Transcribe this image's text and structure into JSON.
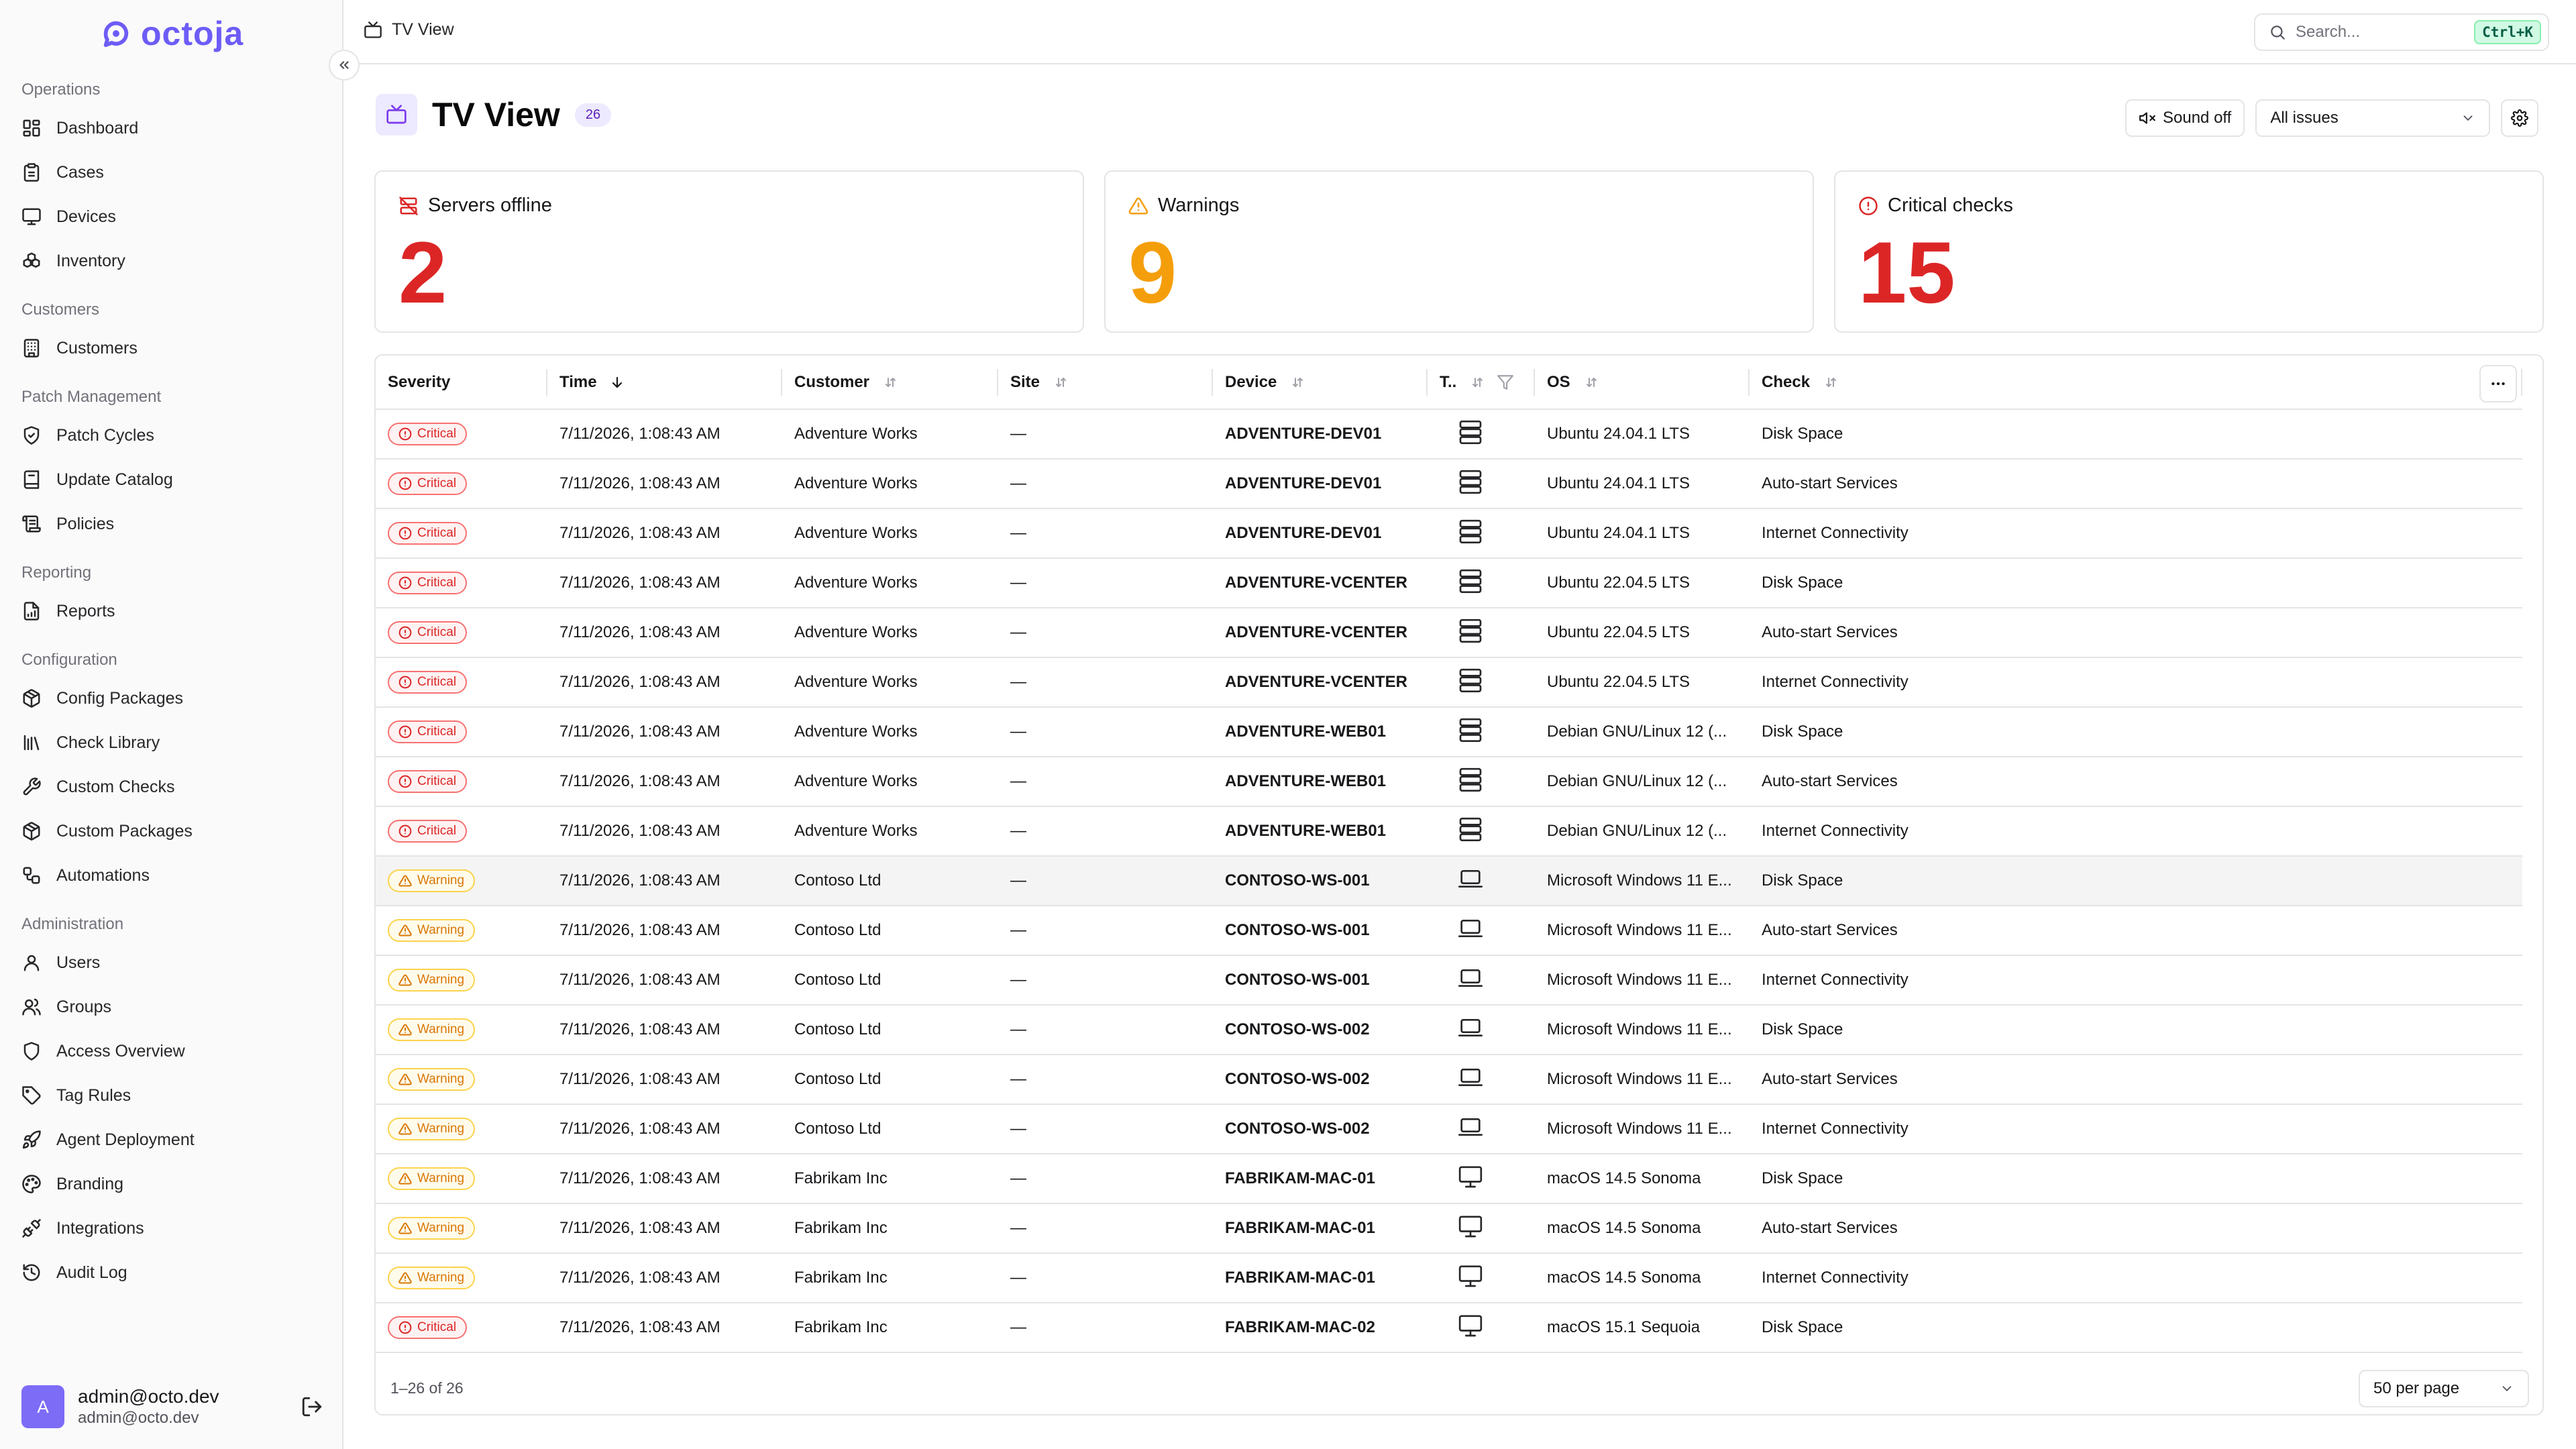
{
  "brand": {
    "name": "octoja",
    "color": "#6d5cf6"
  },
  "sidebar": {
    "sections": [
      {
        "title": "Operations",
        "items": [
          {
            "label": "Dashboard",
            "icon": "dashboard-icon"
          },
          {
            "label": "Cases",
            "icon": "clipboard-icon"
          },
          {
            "label": "Devices",
            "icon": "monitor-icon"
          },
          {
            "label": "Inventory",
            "icon": "boxes-icon"
          }
        ]
      },
      {
        "title": "Customers",
        "items": [
          {
            "label": "Customers",
            "icon": "building-icon"
          }
        ]
      },
      {
        "title": "Patch Management",
        "items": [
          {
            "label": "Patch Cycles",
            "icon": "shield-check-icon"
          },
          {
            "label": "Update Catalog",
            "icon": "book-icon"
          },
          {
            "label": "Policies",
            "icon": "scroll-icon"
          }
        ]
      },
      {
        "title": "Reporting",
        "items": [
          {
            "label": "Reports",
            "icon": "file-chart-icon"
          }
        ]
      },
      {
        "title": "Configuration",
        "items": [
          {
            "label": "Config Packages",
            "icon": "package-icon"
          },
          {
            "label": "Check Library",
            "icon": "library-icon"
          },
          {
            "label": "Custom Checks",
            "icon": "wrench-icon"
          },
          {
            "label": "Custom Packages",
            "icon": "package-icon"
          },
          {
            "label": "Automations",
            "icon": "workflow-icon"
          }
        ]
      },
      {
        "title": "Administration",
        "items": [
          {
            "label": "Users",
            "icon": "user-icon"
          },
          {
            "label": "Groups",
            "icon": "users-icon"
          },
          {
            "label": "Access Overview",
            "icon": "shield-icon"
          },
          {
            "label": "Tag Rules",
            "icon": "tag-icon"
          },
          {
            "label": "Agent Deployment",
            "icon": "rocket-icon"
          },
          {
            "label": "Branding",
            "icon": "palette-icon"
          },
          {
            "label": "Integrations",
            "icon": "plug-icon"
          },
          {
            "label": "Audit Log",
            "icon": "history-icon"
          }
        ]
      }
    ]
  },
  "user": {
    "initial": "A",
    "name": "admin@octo.dev",
    "email": "admin@octo.dev"
  },
  "topbar": {
    "breadcrumb": "TV View",
    "search_placeholder": "Search...",
    "shortcut": "Ctrl+K"
  },
  "page": {
    "title": "TV View",
    "count": "26",
    "sound_label": "Sound off",
    "filter_value": "All issues"
  },
  "stats": [
    {
      "label": "Servers offline",
      "value": "2",
      "color": "#dc2626",
      "icon": "server-off-icon"
    },
    {
      "label": "Warnings",
      "value": "9",
      "color": "#f59e0b",
      "icon": "warning-triangle-icon"
    },
    {
      "label": "Critical checks",
      "value": "15",
      "color": "#dc2626",
      "icon": "alert-circle-icon"
    }
  ],
  "table": {
    "columns": [
      "Severity",
      "Time",
      "Customer",
      "Site",
      "Device",
      "T..",
      "OS",
      "Check"
    ],
    "rows": [
      {
        "severity": "Critical",
        "time": "7/11/2026, 1:08:43 AM",
        "customer": "Adventure Works",
        "site": "—",
        "device": "ADVENTURE-DEV01",
        "type": "server",
        "os": "Ubuntu 24.04.1 LTS",
        "check": "Disk Space"
      },
      {
        "severity": "Critical",
        "time": "7/11/2026, 1:08:43 AM",
        "customer": "Adventure Works",
        "site": "—",
        "device": "ADVENTURE-DEV01",
        "type": "server",
        "os": "Ubuntu 24.04.1 LTS",
        "check": "Auto-start Services"
      },
      {
        "severity": "Critical",
        "time": "7/11/2026, 1:08:43 AM",
        "customer": "Adventure Works",
        "site": "—",
        "device": "ADVENTURE-DEV01",
        "type": "server",
        "os": "Ubuntu 24.04.1 LTS",
        "check": "Internet Connectivity"
      },
      {
        "severity": "Critical",
        "time": "7/11/2026, 1:08:43 AM",
        "customer": "Adventure Works",
        "site": "—",
        "device": "ADVENTURE-VCENTER",
        "type": "server",
        "os": "Ubuntu 22.04.5 LTS",
        "check": "Disk Space"
      },
      {
        "severity": "Critical",
        "time": "7/11/2026, 1:08:43 AM",
        "customer": "Adventure Works",
        "site": "—",
        "device": "ADVENTURE-VCENTER",
        "type": "server",
        "os": "Ubuntu 22.04.5 LTS",
        "check": "Auto-start Services"
      },
      {
        "severity": "Critical",
        "time": "7/11/2026, 1:08:43 AM",
        "customer": "Adventure Works",
        "site": "—",
        "device": "ADVENTURE-VCENTER",
        "type": "server",
        "os": "Ubuntu 22.04.5 LTS",
        "check": "Internet Connectivity"
      },
      {
        "severity": "Critical",
        "time": "7/11/2026, 1:08:43 AM",
        "customer": "Adventure Works",
        "site": "—",
        "device": "ADVENTURE-WEB01",
        "type": "server",
        "os": "Debian GNU/Linux 12 (...",
        "check": "Disk Space"
      },
      {
        "severity": "Critical",
        "time": "7/11/2026, 1:08:43 AM",
        "customer": "Adventure Works",
        "site": "—",
        "device": "ADVENTURE-WEB01",
        "type": "server",
        "os": "Debian GNU/Linux 12 (...",
        "check": "Auto-start Services"
      },
      {
        "severity": "Critical",
        "time": "7/11/2026, 1:08:43 AM",
        "customer": "Adventure Works",
        "site": "—",
        "device": "ADVENTURE-WEB01",
        "type": "server",
        "os": "Debian GNU/Linux 12 (...",
        "check": "Internet Connectivity"
      },
      {
        "severity": "Warning",
        "time": "7/11/2026, 1:08:43 AM",
        "customer": "Contoso Ltd",
        "site": "—",
        "device": "CONTOSO-WS-001",
        "type": "laptop",
        "os": "Microsoft Windows 11 E...",
        "check": "Disk Space"
      },
      {
        "severity": "Warning",
        "time": "7/11/2026, 1:08:43 AM",
        "customer": "Contoso Ltd",
        "site": "—",
        "device": "CONTOSO-WS-001",
        "type": "laptop",
        "os": "Microsoft Windows 11 E...",
        "check": "Auto-start Services"
      },
      {
        "severity": "Warning",
        "time": "7/11/2026, 1:08:43 AM",
        "customer": "Contoso Ltd",
        "site": "—",
        "device": "CONTOSO-WS-001",
        "type": "laptop",
        "os": "Microsoft Windows 11 E...",
        "check": "Internet Connectivity"
      },
      {
        "severity": "Warning",
        "time": "7/11/2026, 1:08:43 AM",
        "customer": "Contoso Ltd",
        "site": "—",
        "device": "CONTOSO-WS-002",
        "type": "laptop",
        "os": "Microsoft Windows 11 E...",
        "check": "Disk Space"
      },
      {
        "severity": "Warning",
        "time": "7/11/2026, 1:08:43 AM",
        "customer": "Contoso Ltd",
        "site": "—",
        "device": "CONTOSO-WS-002",
        "type": "laptop",
        "os": "Microsoft Windows 11 E...",
        "check": "Auto-start Services"
      },
      {
        "severity": "Warning",
        "time": "7/11/2026, 1:08:43 AM",
        "customer": "Contoso Ltd",
        "site": "—",
        "device": "CONTOSO-WS-002",
        "type": "laptop",
        "os": "Microsoft Windows 11 E...",
        "check": "Internet Connectivity"
      },
      {
        "severity": "Warning",
        "time": "7/11/2026, 1:08:43 AM",
        "customer": "Fabrikam Inc",
        "site": "—",
        "device": "FABRIKAM-MAC-01",
        "type": "desktop",
        "os": "macOS 14.5 Sonoma",
        "check": "Disk Space"
      },
      {
        "severity": "Warning",
        "time": "7/11/2026, 1:08:43 AM",
        "customer": "Fabrikam Inc",
        "site": "—",
        "device": "FABRIKAM-MAC-01",
        "type": "desktop",
        "os": "macOS 14.5 Sonoma",
        "check": "Auto-start Services"
      },
      {
        "severity": "Warning",
        "time": "7/11/2026, 1:08:43 AM",
        "customer": "Fabrikam Inc",
        "site": "—",
        "device": "FABRIKAM-MAC-01",
        "type": "desktop",
        "os": "macOS 14.5 Sonoma",
        "check": "Internet Connectivity"
      },
      {
        "severity": "Critical",
        "time": "7/11/2026, 1:08:43 AM",
        "customer": "Fabrikam Inc",
        "site": "—",
        "device": "FABRIKAM-MAC-02",
        "type": "desktop",
        "os": "macOS 15.1 Sequoia",
        "check": "Disk Space"
      }
    ],
    "pagination": {
      "range": "1–26 of 26",
      "per_page": "50 per page"
    }
  }
}
